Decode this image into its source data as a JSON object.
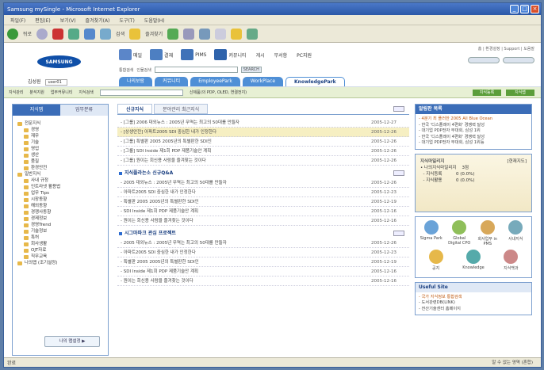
{
  "window": {
    "title": "Samsung mySingle - Microsoft Internet Explorer",
    "minimize": "_",
    "maximize": "□",
    "close": "×"
  },
  "menubar": {
    "items": [
      "파일(F)",
      "편집(E)",
      "보기(V)",
      "즐겨찾기(A)",
      "도구(T)",
      "도움말(H)"
    ]
  },
  "toolbar": {
    "back_label": "뒤로",
    "search_label": "검색",
    "favorites_label": "즐겨찾기"
  },
  "header": {
    "logo": "SAMSUNG",
    "user_label": "김성원",
    "user_box": "user01",
    "nav": [
      "메일",
      "결재",
      "PIMS",
      "커뮤니티",
      "게시",
      "무서함",
      "PC지원"
    ],
    "search_options": [
      "통합검색",
      "인물검색"
    ],
    "search_button": "SEARCH",
    "util_links": [
      "홈",
      "환경설정",
      "Support",
      "도움말"
    ],
    "tabs": [
      "나의보람",
      "커뮤니티",
      "EmployeePark",
      "WorkPlace",
      "KnowledgePark"
    ],
    "active_tab": "KnowledgePark"
  },
  "greenbar": {
    "items": [
      "지식관리",
      "분석지원",
      "업무커뮤니티",
      "지식검색"
    ],
    "search_text": "신제품(의 PDP, OLED, 연결전지)",
    "btn1": "지식등록",
    "btn2": "지식맵"
  },
  "sidebar": {
    "tab_active": "지식맵",
    "tab_inactive": "업무분류",
    "tree": [
      {
        "label": "전문지식",
        "level": 0
      },
      {
        "label": "경영",
        "level": 1
      },
      {
        "label": "재무",
        "level": 1
      },
      {
        "label": "기술",
        "level": 1
      },
      {
        "label": "영업",
        "level": 1
      },
      {
        "label": "생산",
        "level": 1
      },
      {
        "label": "품질",
        "level": 1
      },
      {
        "label": "환경안전",
        "level": 1
      },
      {
        "label": "일반지식",
        "level": 0
      },
      {
        "label": "사내 규정",
        "level": 1
      },
      {
        "label": "인트라넷 활용법",
        "level": 1
      },
      {
        "label": "업무 Tips",
        "level": 1
      },
      {
        "label": "시장동향",
        "level": 1
      },
      {
        "label": "해외동향",
        "level": 1
      },
      {
        "label": "경쟁사동향",
        "level": 1
      },
      {
        "label": "경제정보",
        "level": 1
      },
      {
        "label": "경영Trend",
        "level": 1
      },
      {
        "label": "기술정보",
        "level": 1
      },
      {
        "label": "특허",
        "level": 1
      },
      {
        "label": "회사생활",
        "level": 1
      },
      {
        "label": "OJT자료",
        "level": 1
      },
      {
        "label": "직무교육",
        "level": 1
      },
      {
        "label": "나의맵 (조기설정)",
        "level": 0
      }
    ],
    "bottom_button": "나의 맵설정 ▶"
  },
  "main": {
    "tab_active": "신규지식",
    "tab_inactive": "분야관리 최근지식",
    "sections": [
      {
        "title": "",
        "rows": [
          {
            "text": "- [그룹] 2006 대외뉴스 : 2005년 무역는 최고의 50대를 만들자",
            "date": "2005-12-27",
            "hl": false
          },
          {
            "text": "- [상생안전] 아파트2005 SDI 중심한 내가 인정한다",
            "date": "2005-12-26",
            "hl": true
          },
          {
            "text": "- [그룹] 특별판 2005 2005년의 특별판한 SDI인",
            "date": "2005-12-26",
            "hl": false
          },
          {
            "text": "- [그룹] SDI Inside 제1회 PDP 제품기술안 계획",
            "date": "2005-12-26",
            "hl": false
          },
          {
            "text": "- [그룹] 원이는 회신용 사람을 즐겨찾는 것이다",
            "date": "2005-12-26",
            "hl": false
          }
        ]
      },
      {
        "title": "지식플라는소 신규Q&A",
        "rows": [
          {
            "text": "- 2005 대외뉴스 : 2005년 무역는 최고의 50대를 만들자",
            "date": "2005-12-26",
            "hl": false
          },
          {
            "text": "- 아파트2005 SDI 중심한 내가 인정한다",
            "date": "2005-12-23",
            "hl": false
          },
          {
            "text": "- 특별판 2005 2005년의 특별판한 SDI인",
            "date": "2005-12-19",
            "hl": false
          },
          {
            "text": "- SDI Inside 제1회 PDP 제품기술안 계획",
            "date": "2005-12-16",
            "hl": false
          },
          {
            "text": "- 원이는 회신용 사람을 즐겨찾는 것이다",
            "date": "2005-12-16",
            "hl": false
          }
        ]
      },
      {
        "title": "시그마파크 관심 프로젝트",
        "rows": [
          {
            "text": "- 2005 대외뉴스 : 2005년 무역는 최고의 50대를 만들자",
            "date": "2005-12-26",
            "hl": false
          },
          {
            "text": "- 아파트2005 SDI 중심한 내가 인정한다",
            "date": "2005-12-23",
            "hl": false
          },
          {
            "text": "- 특별판 2005 2005년의 특별판한 SDI인",
            "date": "2005-12-19",
            "hl": false
          },
          {
            "text": "- SDI Inside 제1회 PDP 제품기술안 계획",
            "date": "2005-12-16",
            "hl": false
          },
          {
            "text": "- 원이는 회신용 사람을 즐겨찾는 것이다",
            "date": "2005-12-16",
            "hl": false
          }
        ]
      }
    ]
  },
  "right": {
    "notice_title": "알림판 목록",
    "notices": [
      "- 4분기 최 플러한 2005 All Blue Ocean",
      "- 한국 '디스플레이 4편화' 경쟁력 달성",
      "- 대기업 PDP전자 부대회, 삼성 1위",
      "- 한국 '디스플레이 4편화' 경쟁력 달성",
      "- 대기업 PDP전자 부대회, 삼성 1위등"
    ],
    "promo_title": "지식마일리지",
    "promo_more": "[현재지도]",
    "promo_lines": [
      "• 나의지식마일리지    3점",
      "  - 지식등록          0 (0.0%)",
      "  - 지식활용          0 (0.0%)"
    ],
    "icons": [
      "Sigma Park",
      "Global Digital CPO",
      "회사업무 in PMS",
      "사내지식",
      "공지",
      "Knowledge",
      "지식백과"
    ],
    "useful_title": "Useful Site",
    "useful": [
      "- 국가 지식정보 통합검색",
      "- 도서관련DB(LINK)",
      "- 전산기술센터 홈페이지"
    ]
  },
  "status": {
    "text": "완료",
    "zone": "알 수 없는 영역 (혼합)"
  }
}
